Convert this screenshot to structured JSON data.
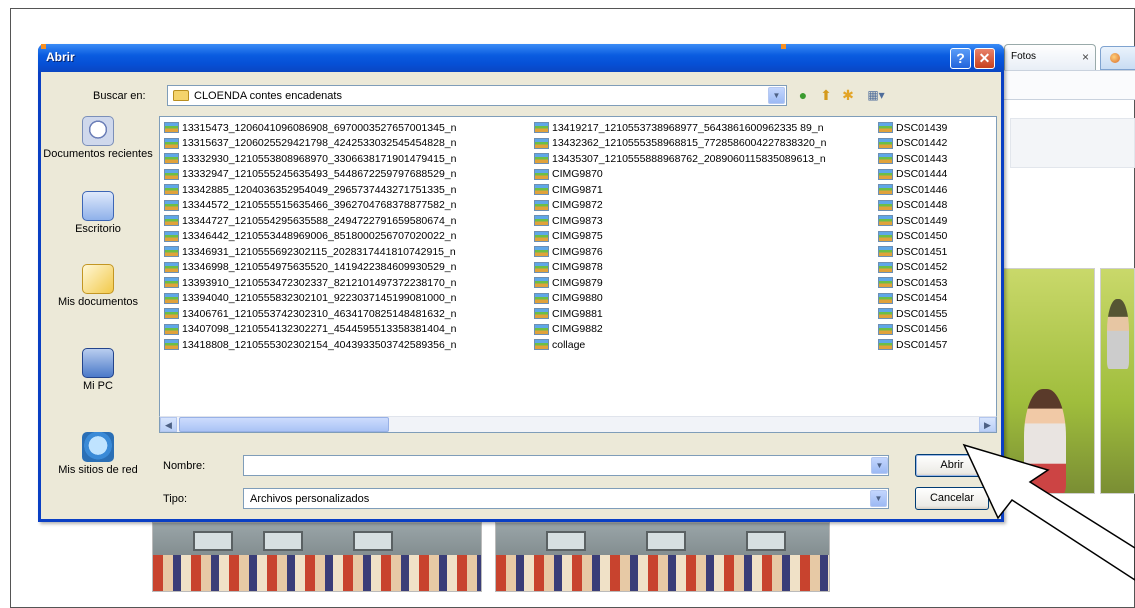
{
  "dialog": {
    "title": "Abrir",
    "help_btn": "?",
    "close_btn": "✕",
    "lookin_label": "Buscar en:",
    "lookin_value": "CLOENDA contes encadenats",
    "name_label": "Nombre:",
    "name_value": "",
    "type_label": "Tipo:",
    "type_value": "Archivos personalizados",
    "open_button": "Abrir",
    "cancel_button": "Cancelar",
    "nav_icons": [
      "back-icon",
      "up-folder-icon",
      "new-folder-icon",
      "view-menu-icon"
    ]
  },
  "places": [
    {
      "label": "Documentos recientes",
      "icon": "recent-documents-icon"
    },
    {
      "label": "Escritorio",
      "icon": "desktop-icon"
    },
    {
      "label": "Mis documentos",
      "icon": "my-documents-icon"
    },
    {
      "label": "Mi PC",
      "icon": "my-computer-icon"
    },
    {
      "label": "Mis sitios de red",
      "icon": "network-places-icon"
    }
  ],
  "files": {
    "col1": [
      "13315473_1206041096086908_6970003527657001345_n",
      "13315637_1206025529421798_4242533032545454828_n",
      "13332930_1210553808968970_3306638171901479415_n",
      "13332947_1210555245635493_5448672259797688529_n",
      "13342885_1204036352954049_2965737443271751335_n",
      "13344572_1210555515635466_3962704768378877582_n",
      "13344727_1210554295635588_2494722791659580674_n",
      "13346442_1210553448969006_8518000256707020022_n",
      "13346931_1210555692302115_2028317441810742915_n",
      "13346998_1210554975635520_1419422384609930529_n",
      "13393910_1210553472302337_8212101497372238170_n",
      "13394040_1210555832302101_9223037145199081000_n",
      "13406761_1210553742302310_4634170825148481632_n",
      "13407098_1210554132302271_4544595513358381404_n",
      "13418808_1210555302302154_4043933503742589356_n"
    ],
    "col2": [
      "13419217_1210553738968977_5643861600962335 89_n",
      "13432362_1210555358968815_7728586004227838320_n",
      "13435307_1210555888968762_2089060115835089613_n",
      "CIMG9870",
      "CIMG9871",
      "CIMG9872",
      "CIMG9873",
      "CIMG9875",
      "CIMG9876",
      "CIMG9878",
      "CIMG9879",
      "CIMG9880",
      "CIMG9881",
      "CIMG9882",
      "collage"
    ],
    "col3": [
      "DSC01439",
      "DSC01442",
      "DSC01443",
      "DSC01444",
      "DSC01446",
      "DSC01448",
      "DSC01449",
      "DSC01450",
      "DSC01451",
      "DSC01452",
      "DSC01453",
      "DSC01454",
      "DSC01455",
      "DSC01456",
      "DSC01457"
    ]
  },
  "background": {
    "tab_label": "Fotos",
    "tab_close": "×"
  },
  "colors": {
    "titlebar": "#0a5ce0",
    "dialog_bg": "#ece9d8",
    "border": "#7f9db9"
  }
}
